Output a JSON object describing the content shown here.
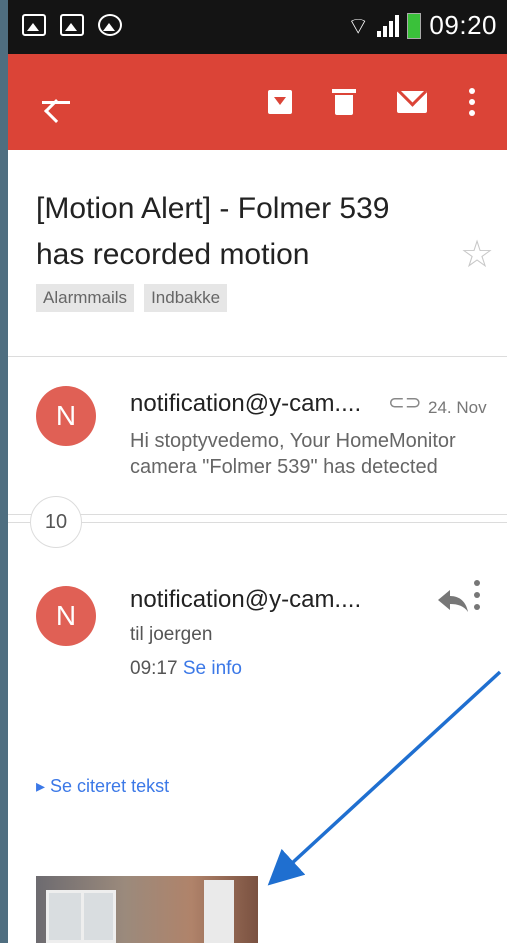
{
  "status_bar": {
    "time": "09:20"
  },
  "toolbar": {
    "back": "back-arrow-icon",
    "actions": [
      "archive-icon",
      "trash-icon",
      "mail-icon",
      "more-vert-icon"
    ]
  },
  "subject": {
    "text": "[Motion Alert] - Folmer 539 has recorded motion",
    "labels": [
      "Alarmmails",
      "Indbakke"
    ]
  },
  "collapsed_message": {
    "avatar_letter": "N",
    "sender": "notification@y-cam....",
    "date": "24. Nov",
    "snippet": "Hi stoptyvedemo, Your HomeMonitor camera \"Folmer 539\" has detected"
  },
  "thread_count": "10",
  "expanded_message": {
    "avatar_letter": "N",
    "sender": "notification@y-cam....",
    "to": "til joergen",
    "time": "09:17",
    "details_link": "Se info",
    "quoted_text": "▸ Se citeret tekst"
  },
  "colors": {
    "toolbar": "#db4437",
    "status_bar": "#141414",
    "avatar": "#e06055",
    "link": "#3b78e7",
    "annotation_arrow": "#1f6fd0"
  }
}
